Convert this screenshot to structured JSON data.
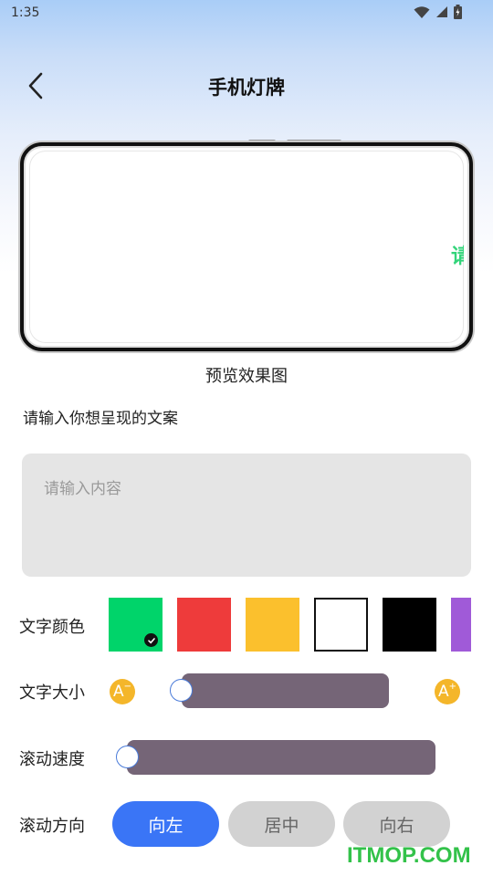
{
  "status_bar": {
    "time": "1:35"
  },
  "header": {
    "title": "手机灯牌",
    "back_icon": "chevron-left-icon"
  },
  "preview": {
    "marquee_text": "请",
    "caption": "预览效果图",
    "marquee_color": "#33d47a"
  },
  "input": {
    "label": "请输入你想呈现的文案",
    "placeholder": "请输入内容",
    "value": ""
  },
  "text_color": {
    "label": "文字颜色",
    "selected": 0,
    "options": [
      "#00d46a",
      "#ee3b3b",
      "#fbc02d",
      "#ffffff",
      "#000000",
      "#a05ad8"
    ]
  },
  "text_size": {
    "label": "文字大小",
    "decrease_icon": "font-decrease-icon",
    "increase_icon": "font-increase-icon",
    "level": 0.0
  },
  "scroll_speed": {
    "label": "滚动速度",
    "level": 0.0
  },
  "scroll_direction": {
    "label": "滚动方向",
    "options": [
      "向左",
      "居中",
      "向右"
    ],
    "selected": 0
  },
  "colors": {
    "accent": "#3a75f6",
    "slider_track": "#756577",
    "inactive_button": "#d2d2d2"
  },
  "watermark": "ITMOP.COM"
}
